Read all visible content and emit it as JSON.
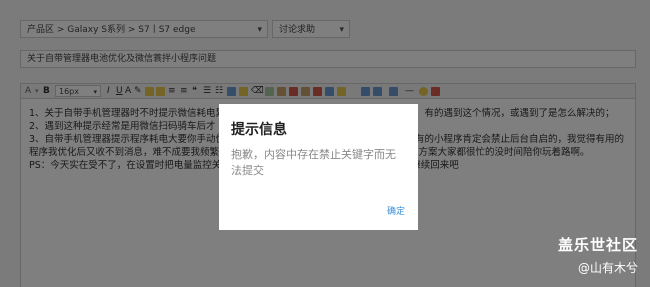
{
  "form": {
    "category_select": "产品区 > Galaxy S系列 > S7丨S7 edge",
    "type_select": "讨论求助",
    "title_value": "关于自带管理器电池优化及微信蓑拌小程序问题",
    "font_size": "16px"
  },
  "editor": {
    "lines": [
      "1、关于自带手机管理器时不时提示微信耗电异常是怎么回事？遇到这个情况时是否可以忽略，有的遇到这个情况，或遇到了是怎么解决的；",
      "2、遇到这种提示经常是用微信扫码骑车后才",
      "3、自带手机管理器提示程序耗电大要你手动优化，是否说明一般都会禁止微信的后台运行，有的小程序肯定会禁止后台自启的，我觉得有用的",
      "程序我优化后又收不到消息，难不成要我频繁手动将它加入白名单吗？还是说现在的这个优化方案大家都很忙的没时间陪你玩着路啊。",
      "PS：今天实在受不了，在设置时把电量监控关闭了，看能否解决问题，明天或以后可能还会继续回来吧"
    ]
  },
  "dialog": {
    "title": "提示信息",
    "message": "抱歉，内容中存在禁止关键字而无法提交",
    "ok_label": "确定"
  },
  "watermark": {
    "line1": "盖乐世社区",
    "line2": "@山有木兮"
  },
  "colors": {
    "overlay": "rgba(0,0,0,0.5)",
    "link_blue": "#3a8fd8"
  }
}
